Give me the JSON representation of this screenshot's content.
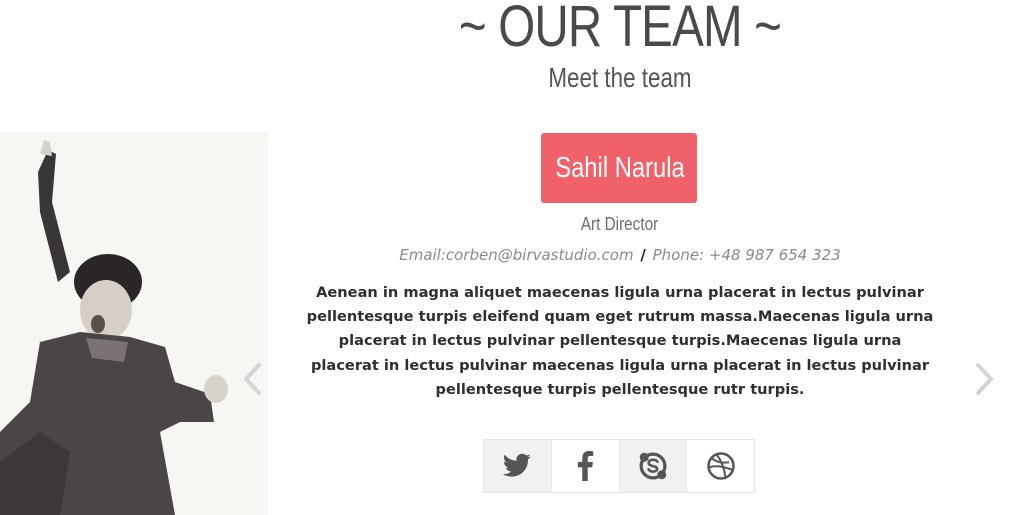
{
  "section": {
    "title": "~ OUR TEAM ~",
    "subtitle": "Meet the team"
  },
  "member": {
    "name": "Sahil Narula",
    "role": "Art Director",
    "email_text": "Email:corben@birvastudio.com",
    "separator": "/",
    "phone_text": "Phone: +48 987 654 323",
    "bio": "Aenean in magna aliquet maecenas ligula urna placerat in lectus pulvinar pellentesque turpis eleifend quam eget rutrum massa.Maecenas ligula urna placerat in lectus pulvinar pellentesque turpis.Maecenas ligula urna placerat in lectus pulvinar maecenas ligula urna placerat in lectus pulvinar pellentesque turpis pellentesque rutr turpis."
  },
  "carousel": {
    "prev_icon": "chevron-left-icon",
    "next_icon": "chevron-right-icon"
  },
  "social": [
    {
      "icon": "twitter-icon"
    },
    {
      "icon": "facebook-icon"
    },
    {
      "icon": "skype-icon"
    },
    {
      "icon": "dribbble-icon"
    }
  ],
  "colors": {
    "accent": "#f0616a",
    "title": "#4a4a4a",
    "icon": "#555555",
    "arrow": "#d4d4d4"
  }
}
